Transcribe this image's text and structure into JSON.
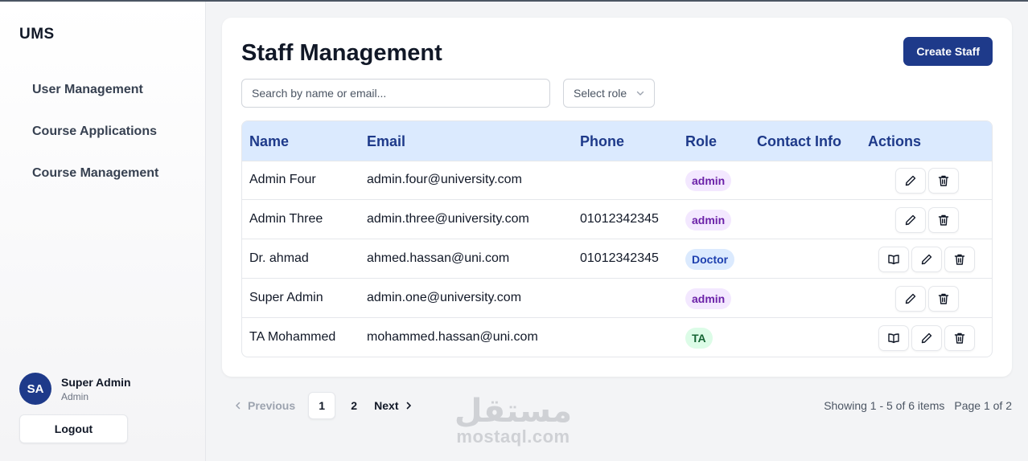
{
  "app": {
    "brand": "UMS"
  },
  "sidebar": {
    "items": [
      {
        "label": "User Management"
      },
      {
        "label": "Course Applications"
      },
      {
        "label": "Course Management"
      }
    ],
    "user": {
      "initials": "SA",
      "name": "Super Admin",
      "role": "Admin"
    },
    "logout_label": "Logout"
  },
  "page": {
    "title": "Staff Management",
    "create_label": "Create Staff",
    "search": {
      "placeholder": "Search by name or email...",
      "value": ""
    },
    "role_select": {
      "label": "Select role"
    }
  },
  "table": {
    "headers": [
      "Name",
      "Email",
      "Phone",
      "Role",
      "Contact Info",
      "Actions"
    ],
    "rows": [
      {
        "name": "Admin Four",
        "email": "admin.four@university.com",
        "phone": "",
        "role": "admin",
        "contact": "",
        "actions": [
          "edit",
          "delete"
        ]
      },
      {
        "name": "Admin Three",
        "email": "admin.three@university.com",
        "phone": "01012342345",
        "role": "admin",
        "contact": "",
        "actions": [
          "edit",
          "delete"
        ]
      },
      {
        "name": "Dr. ahmad",
        "email": "ahmed.hassan@uni.com",
        "phone": "01012342345",
        "role": "Doctor",
        "contact": "",
        "actions": [
          "courses",
          "edit",
          "delete"
        ]
      },
      {
        "name": "Super Admin",
        "email": "admin.one@university.com",
        "phone": "",
        "role": "admin",
        "contact": "",
        "actions": [
          "edit",
          "delete"
        ]
      },
      {
        "name": "TA Mohammed",
        "email": "mohammed.hassan@uni.com",
        "phone": "",
        "role": "TA",
        "contact": "",
        "actions": [
          "courses",
          "edit",
          "delete"
        ]
      }
    ]
  },
  "pagination": {
    "previous_label": "Previous",
    "pages": [
      "1",
      "2"
    ],
    "current_page": "1",
    "next_label": "Next",
    "showing": "Showing 1 - 5 of 6 items",
    "page_of": "Page 1 of 2"
  },
  "watermark": {
    "arabic": "مستقل",
    "latin": "mostaql.com"
  },
  "colors": {
    "primary": "#1e3a8a",
    "header_bg": "#dbeafe",
    "admin_badge": "#f3e8ff",
    "doctor_badge": "#dbeafe",
    "ta_badge": "#dcfce7"
  }
}
